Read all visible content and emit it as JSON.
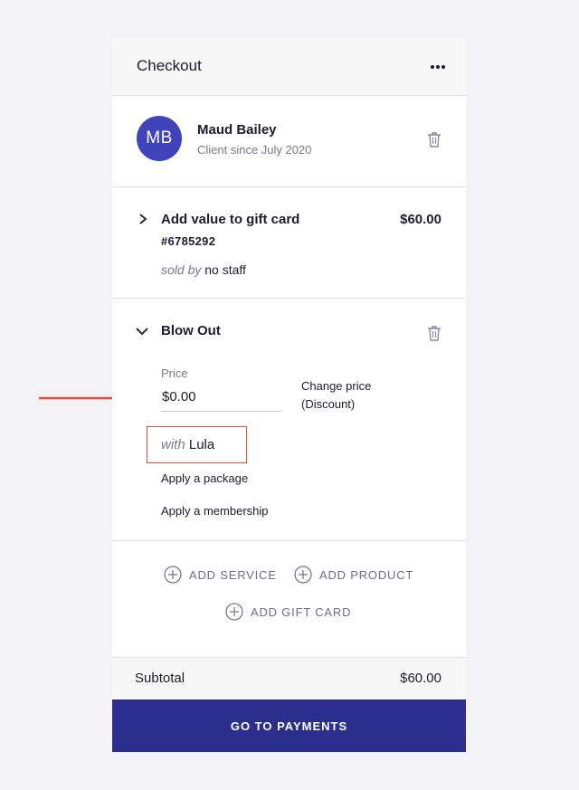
{
  "header": {
    "title": "Checkout",
    "more_icon": "more-horizontal-icon"
  },
  "client": {
    "initials": "MB",
    "avatar_color": "#3f44b8",
    "name": "Maud Bailey",
    "since": "Client since July 2020"
  },
  "gift_card_item": {
    "title": "Add value to gift card",
    "price": "$60.00",
    "code": "#6785292",
    "sold_by_label": "sold by",
    "sold_by_value": "no staff"
  },
  "service_item": {
    "title": "Blow Out",
    "price_label": "Price",
    "price_value": "$0.00",
    "change_price_line1": "Change price",
    "change_price_line2": "(Discount)",
    "with_label": "with",
    "with_value": "Lula",
    "apply_package": "Apply a package",
    "apply_membership": "Apply a membership"
  },
  "actions": {
    "add_service": "ADD SERVICE",
    "add_product": "ADD PRODUCT",
    "add_gift_card": "ADD GIFT CARD"
  },
  "summary": {
    "subtotal_label": "Subtotal",
    "subtotal_value": "$60.00"
  },
  "footer": {
    "pay_button": "GO TO PAYMENTS"
  },
  "colors": {
    "primary": "#2b2e8c",
    "avatar": "#3f44b8",
    "annotation": "#e04b3c"
  }
}
